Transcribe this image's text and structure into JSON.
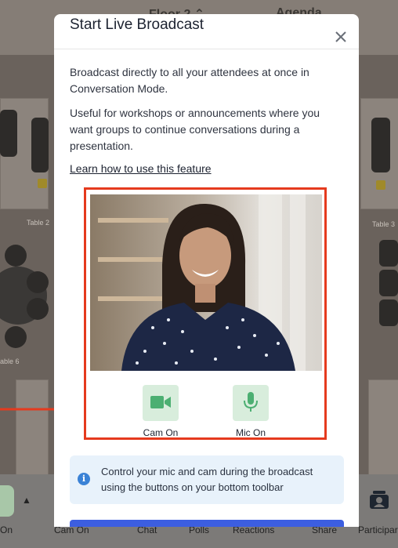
{
  "background": {
    "floor_label": "Floor 2 ⌃",
    "agenda_label": "Agenda",
    "table_labels": [
      "Table 2",
      "Table 3",
      "able 6"
    ]
  },
  "toolbar": {
    "items": [
      "On",
      "Cam On",
      "Chat",
      "Polls",
      "Reactions",
      "Share",
      "Participar"
    ]
  },
  "modal": {
    "title": "Start Live Broadcast",
    "paragraph1": "Broadcast directly to all your attendees at once in Conversation Mode.",
    "paragraph2": "Useful for workshops or announcements where you want groups to continue conversations during a presentation.",
    "learn_link": "Learn how to use this feature",
    "cam_label": "Cam On",
    "mic_label": "Mic On",
    "info_text": "Control your mic and cam during the broadcast using the buttons on your bottom toolbar"
  },
  "colors": {
    "highlight": "#e53a1e",
    "control_bg": "#d8eddc",
    "control_icon": "#4caf72",
    "info_bg": "#e8f2fb",
    "primary": "#3c5ee0"
  },
  "icons": {
    "cam": "video-camera-icon",
    "mic": "microphone-icon",
    "close": "close-icon",
    "info": "info-icon",
    "arrow": "arrow-right-icon"
  }
}
